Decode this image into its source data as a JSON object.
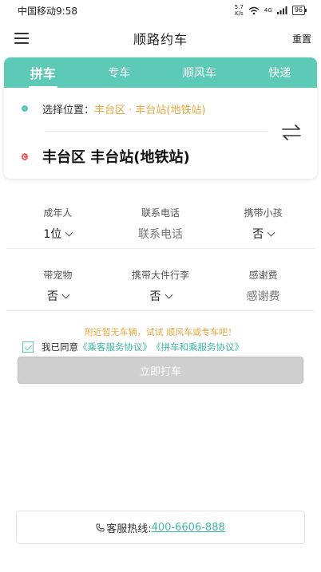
{
  "status_bar": {
    "carrier_time": "中国移动9:58",
    "net_speed_top": "5.7",
    "net_speed_bottom": "K/s",
    "signal": "4G",
    "battery": "96"
  },
  "header": {
    "title": "顺路约车",
    "reset_label": "重置"
  },
  "tabs": [
    {
      "label": "拼车",
      "active": true
    },
    {
      "label": "专车",
      "active": false
    },
    {
      "label": "顺风车",
      "active": false
    },
    {
      "label": "快递",
      "active": false
    }
  ],
  "location": {
    "origin_label": "选择位置：",
    "origin_value": "丰台区 · 丰台站(地铁站)",
    "destination": "丰台区 丰台站(地铁站)"
  },
  "form": {
    "row1": [
      {
        "label": "成年人",
        "value": "1位",
        "dropdown": true,
        "placeholder": false
      },
      {
        "label": "联系电话",
        "value": "联系电话",
        "dropdown": false,
        "placeholder": true
      },
      {
        "label": "携带小孩",
        "value": "否",
        "dropdown": true,
        "placeholder": false
      }
    ],
    "row2": [
      {
        "label": "带宠物",
        "value": "否",
        "dropdown": true,
        "placeholder": false
      },
      {
        "label": "携带大件行李",
        "value": "否",
        "dropdown": true,
        "placeholder": false
      },
      {
        "label": "感谢费",
        "value": "感谢费",
        "dropdown": false,
        "placeholder": true
      }
    ]
  },
  "notice": "附近暂无车辆，试试 顺风车或专车吧！",
  "agreement": {
    "prefix": "我已同意",
    "link1": "《乘客服务协议》",
    "link2": "《拼车和乘服务协议》",
    "checked": true
  },
  "call_button": "立即打车",
  "hotline": {
    "label": "客服热线:",
    "number": "400-6606-888"
  },
  "colors": {
    "accent": "#5ccab6",
    "warning": "#e9a73c",
    "link": "#3fb8a4"
  }
}
